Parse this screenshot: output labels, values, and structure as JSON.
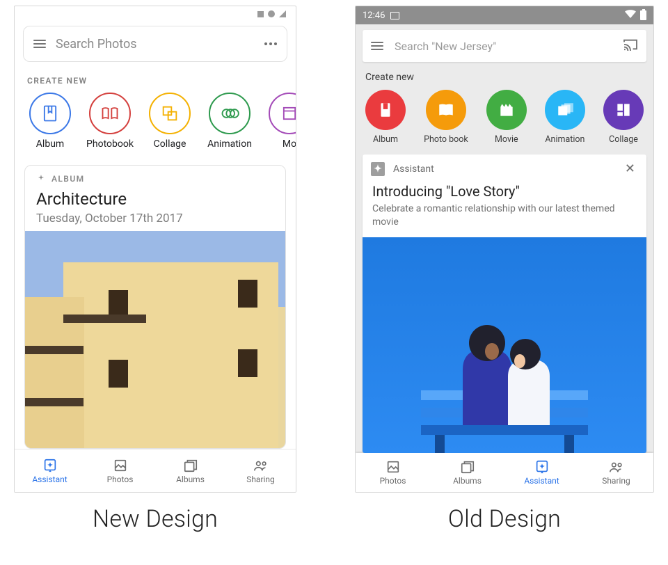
{
  "captions": {
    "left": "New Design",
    "right": "Old Design"
  },
  "new_design": {
    "search": {
      "placeholder": "Search Photos"
    },
    "section_label": "CREATE NEW",
    "create": [
      {
        "label": "Album",
        "icon": "album-icon",
        "color": "blue"
      },
      {
        "label": "Photobook",
        "icon": "photobook-icon",
        "color": "red"
      },
      {
        "label": "Collage",
        "icon": "collage-icon",
        "color": "yellow"
      },
      {
        "label": "Animation",
        "icon": "animation-icon",
        "color": "green"
      },
      {
        "label": "Mo",
        "icon": "movie-icon",
        "color": "purple"
      }
    ],
    "card": {
      "tag": "ALBUM",
      "title": "Architecture",
      "date": "Tuesday, October 17th 2017"
    },
    "tabs": [
      {
        "label": "Assistant",
        "icon": "assistant-icon",
        "active": true
      },
      {
        "label": "Photos",
        "icon": "photos-icon",
        "active": false
      },
      {
        "label": "Albums",
        "icon": "albums-icon",
        "active": false
      },
      {
        "label": "Sharing",
        "icon": "sharing-icon",
        "active": false
      }
    ]
  },
  "old_design": {
    "statusbar": {
      "time": "12:46"
    },
    "search": {
      "placeholder": "Search \"New Jersey\""
    },
    "section_label": "Create new",
    "create": [
      {
        "label": "Album",
        "icon": "album-icon",
        "color": "red2"
      },
      {
        "label": "Photo book",
        "icon": "photobook-icon",
        "color": "orange"
      },
      {
        "label": "Movie",
        "icon": "movie-icon",
        "color": "green2"
      },
      {
        "label": "Animation",
        "icon": "animation-icon",
        "color": "blue2"
      },
      {
        "label": "Collage",
        "icon": "collage-icon",
        "color": "purple2"
      }
    ],
    "card": {
      "source": "Assistant",
      "title": "Introducing \"Love Story\"",
      "subtitle": "Celebrate a romantic relationship with our latest themed movie"
    },
    "tabs": [
      {
        "label": "Photos",
        "icon": "photos-icon",
        "active": false
      },
      {
        "label": "Albums",
        "icon": "albums-icon",
        "active": false
      },
      {
        "label": "Assistant",
        "icon": "assistant-icon",
        "active": true
      },
      {
        "label": "Sharing",
        "icon": "sharing-icon",
        "active": false
      }
    ]
  }
}
